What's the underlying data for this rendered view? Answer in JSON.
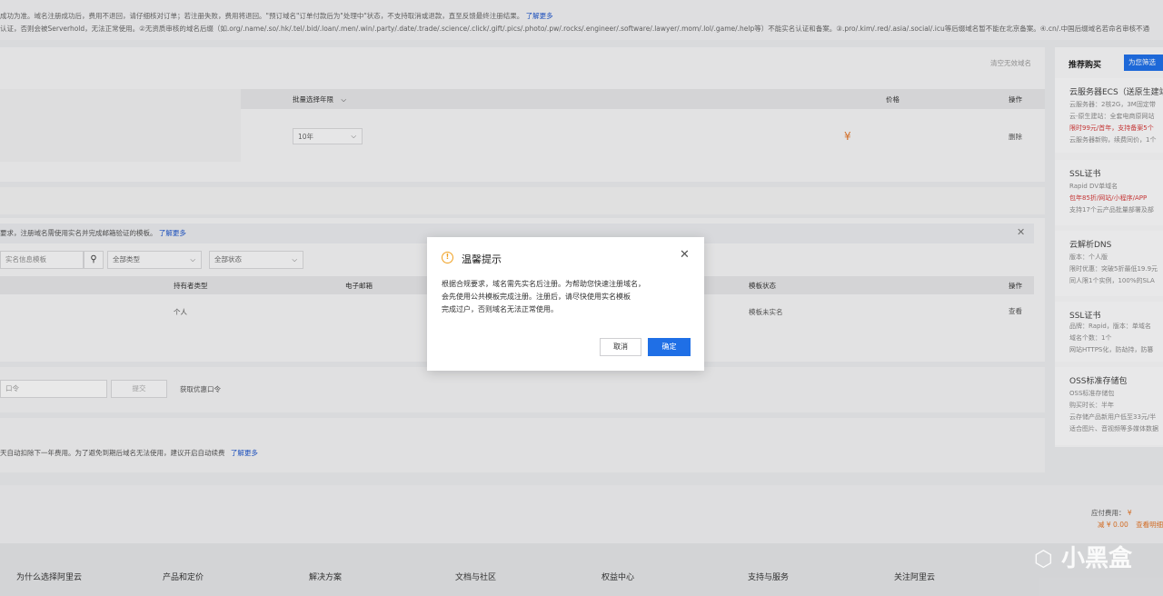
{
  "notice": {
    "line1": "成功为准。域名注册成功后，费用不退回，请仔细核对订单；若注册失败，费用将退回。\"预订域名\"订单付款后为\"处理中\"状态，不支持取消或退款，直至反馈最终注册结果。",
    "line1_link": "了解更多",
    "line2": "认证，否则会被Serverhold，无法正常使用。②无资质审核的域名后缀（如.org/.name/.so/.hk/.tel/.bid/.loan/.men/.win/.party/.date/.trade/.science/.click/.gift/.pics/.photo/.pw/.rocks/.engineer/.software/.lawyer/.mom/.lol/.game/.help等）不能实名认证和备案。③.pro/.kim/.red/.asia/.social/.icu等后缀域名暂不能在北京备案。④.cn/.中国后缀域名若命名审核不通"
  },
  "main": {
    "clear_invalid": "清空无效域名",
    "col_years": "批量选择年限",
    "col_price": "价格",
    "col_action": "操作",
    "years_value": "10年",
    "price_symbol": "¥",
    "delete": "删除"
  },
  "template": {
    "tip": "要求，注册域名需使用实名并完成邮箱验证的模板。",
    "tip_link": "了解更多",
    "search_placeholder": "实名信息模板",
    "type_select": "全部类型",
    "status_select": "全部状态",
    "col_holder_type": "持有者类型",
    "col_email": "电子邮箱",
    "col_template_status": "模板状态",
    "col_action": "操作",
    "row_holder_type": "个人",
    "row_status": "模板未实名",
    "row_action": "查看"
  },
  "coupon": {
    "placeholder": "口令",
    "submit": "提交",
    "get_link": "获取优惠口令"
  },
  "autorenew": {
    "text": "天自动扣除下一年费用。为了避免到期后域名无法使用，建议开启自动续费",
    "link": "了解更多"
  },
  "sidebar": {
    "title": "推荐购买",
    "filter_btn": "为您筛选",
    "cards": [
      {
        "title": "云服务器ECS（送原生建站",
        "lines": [
          "云服务器：2核2G，3M固定带",
          "云-原生建站：全套电商原网站",
          "限时99元/首年，支持备案5个",
          "云服务器新购，续费同价，1个"
        ]
      },
      {
        "title": "SSL证书",
        "lines": [
          "Rapid DV单域名",
          "包年85折/网站/小程序/APP",
          "支持17个云产品批量部署及部"
        ]
      },
      {
        "title": "云解析DNS",
        "lines": [
          "版本：个人版",
          "限时优惠：突破5折最低19.9元",
          "同人限1个实例，100%的SLA"
        ]
      },
      {
        "title": "SSL证书",
        "lines": [
          "品牌：Rapid，版本：单域名",
          "域名个数：1个",
          "网站HTTPS化，防劫持，防篡"
        ]
      },
      {
        "title": "OSS标准存储包",
        "lines": [
          "OSS标准存储包",
          "购买时长：半年",
          "云存储产品新用户低至33元/半",
          "适合图片、音视频等多媒体数据"
        ]
      }
    ]
  },
  "summary": {
    "payable_label": "应付费用：",
    "payable_value": "¥",
    "discount": "减 ¥ 0.00",
    "detail": "查看明细"
  },
  "footer": {
    "cols": [
      "为什么选择阿里云",
      "产品和定价",
      "解决方案",
      "文档与社区",
      "权益中心",
      "支持与服务",
      "关注阿里云"
    ]
  },
  "dialog": {
    "title": "温馨提示",
    "icon": "warning-icon",
    "line1": "根据合规要求，域名需先实名后注册。为帮助您快速注册域名，",
    "line2": "会先使用公共模板完成注册。注册后，请尽快使用实名模板",
    "line3": "完成过户，否则域名无法正常使用。",
    "cancel": "取消",
    "confirm": "确定"
  },
  "watermark": "小黑盒"
}
